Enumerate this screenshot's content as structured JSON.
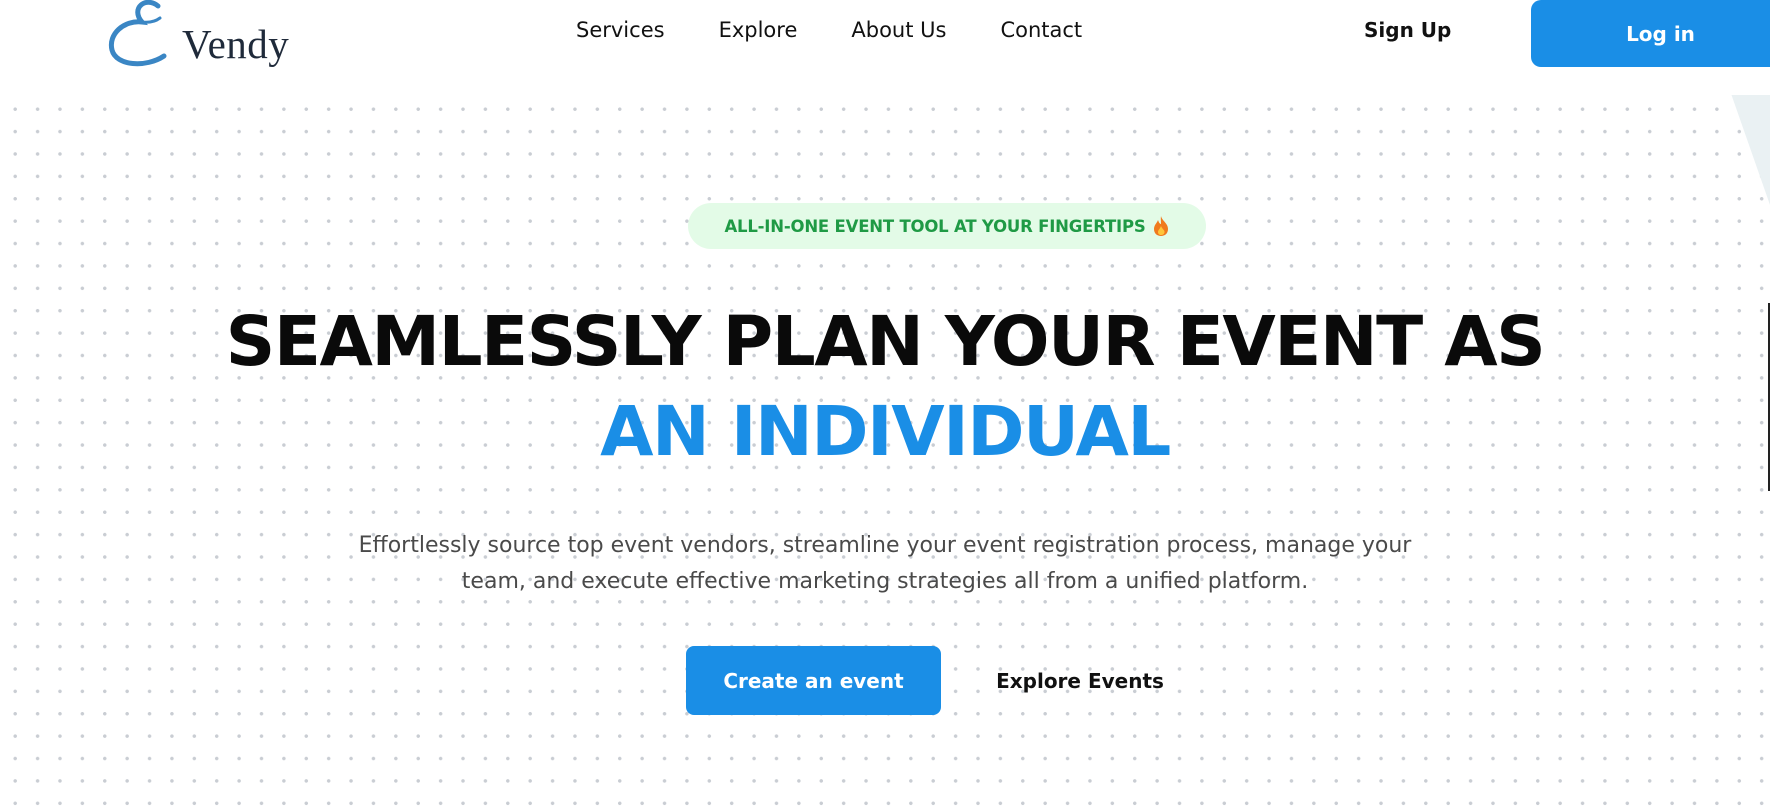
{
  "brand": {
    "logo_text": "Vendy",
    "accent_color": "#1a8ee6",
    "badge_bg": "#e3fbe7",
    "badge_color": "#1f9a45"
  },
  "nav": {
    "items": [
      {
        "label": "Services"
      },
      {
        "label": "Explore"
      },
      {
        "label": "About Us"
      },
      {
        "label": "Contact"
      }
    ],
    "signup_label": "Sign Up",
    "login_label": "Log in"
  },
  "hero": {
    "badge_text": "ALL-IN-ONE EVENT TOOL AT YOUR FINGERTIPS",
    "badge_icon": "fire-icon",
    "headline_line1": "SEAMLESSLY PLAN YOUR EVENT AS",
    "headline_line2": "AN INDIVIDUAL",
    "subtext": "Effortlessly source top event vendors, streamline your event registration process, manage your team, and execute effective marketing strategies all from a unified platform.",
    "primary_cta": "Create an event",
    "secondary_cta": "Explore Events"
  }
}
